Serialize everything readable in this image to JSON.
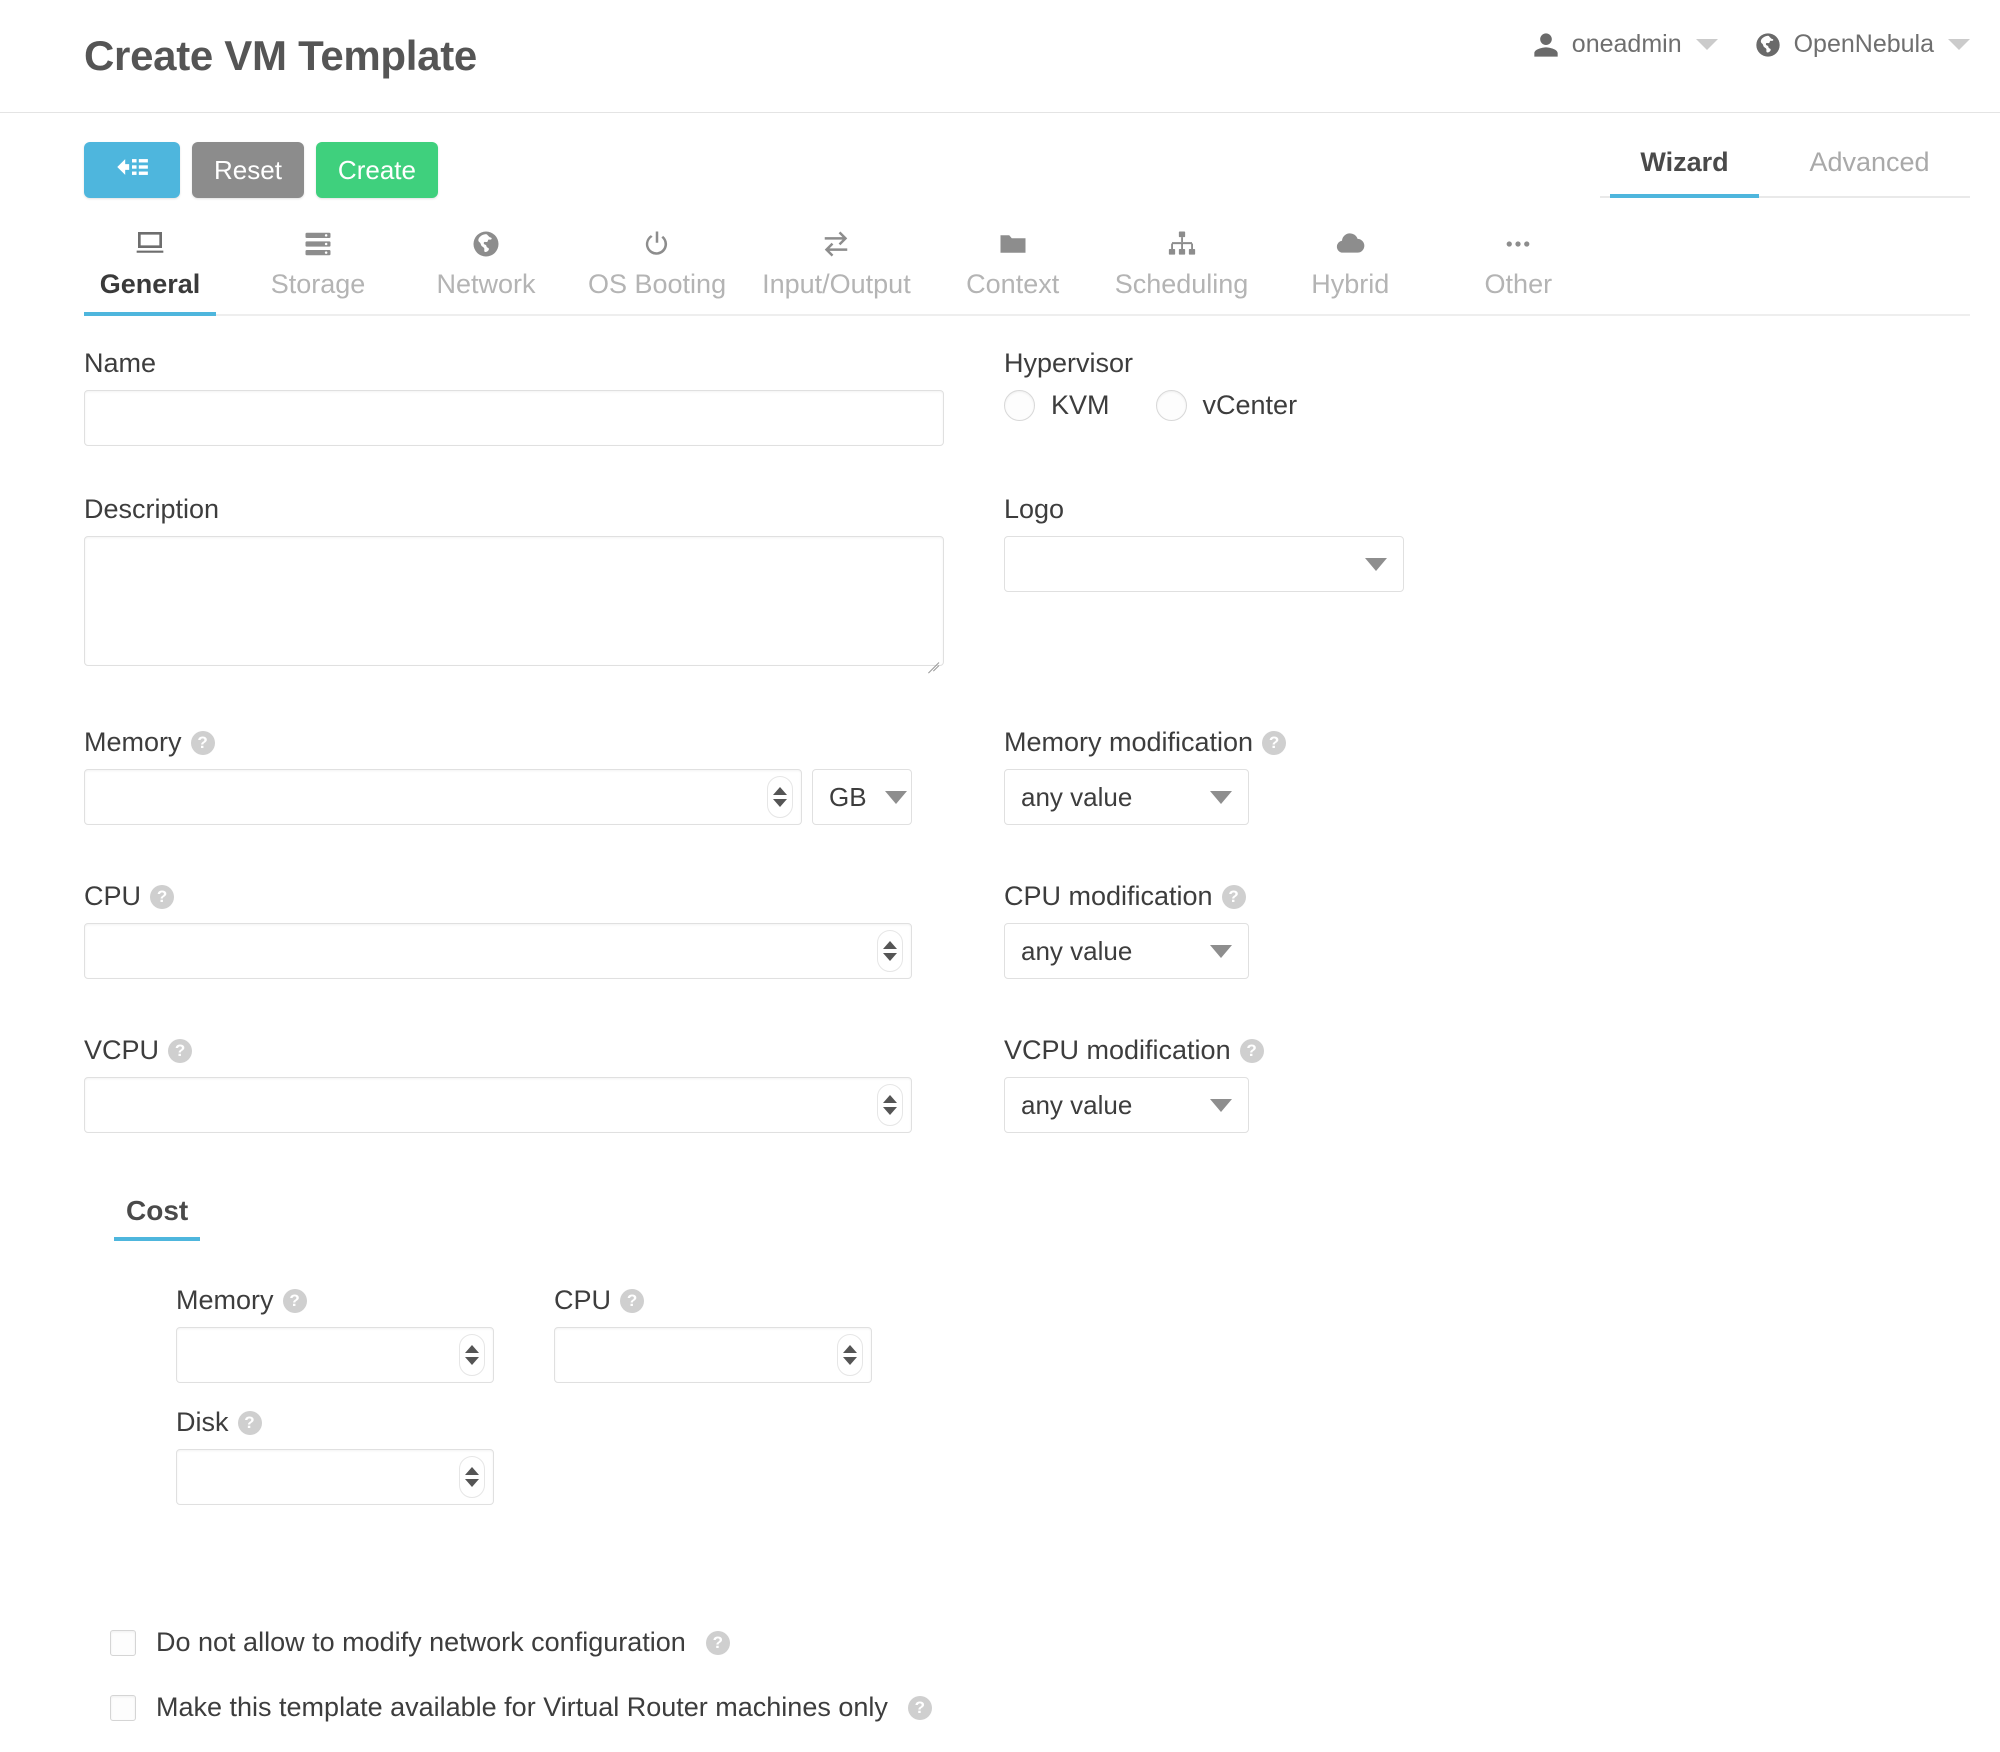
{
  "header": {
    "title": "Create VM Template",
    "user": {
      "name": "oneadmin",
      "icon": "user-icon"
    },
    "zone": {
      "name": "OpenNebula",
      "icon": "globe-icon"
    }
  },
  "toolbar": {
    "back_label": "",
    "reset_label": "Reset",
    "create_label": "Create",
    "back_icon": "back-to-list-icon",
    "colors": {
      "back": "#4eb6dd",
      "reset": "#8c8c8c",
      "create": "#3fd07d",
      "accent": "#4eb6dd"
    }
  },
  "mode_tabs": [
    {
      "label": "Wizard",
      "active": true
    },
    {
      "label": "Advanced",
      "active": false
    }
  ],
  "section_tabs": [
    {
      "label": "General",
      "icon": "desktop-icon",
      "active": true
    },
    {
      "label": "Storage",
      "icon": "server-icon",
      "active": false
    },
    {
      "label": "Network",
      "icon": "globe-icon",
      "active": false
    },
    {
      "label": "OS Booting",
      "icon": "power-icon",
      "active": false
    },
    {
      "label": "Input/Output",
      "icon": "exchange-icon",
      "active": false
    },
    {
      "label": "Context",
      "icon": "folder-icon",
      "active": false
    },
    {
      "label": "Scheduling",
      "icon": "sitemap-icon",
      "active": false
    },
    {
      "label": "Hybrid",
      "icon": "cloud-icon",
      "active": false
    },
    {
      "label": "Other",
      "icon": "ellipsis-icon",
      "active": false
    }
  ],
  "form": {
    "name": {
      "label": "Name",
      "value": "",
      "placeholder": ""
    },
    "description": {
      "label": "Description",
      "value": "",
      "placeholder": ""
    },
    "hypervisor": {
      "label": "Hypervisor",
      "options": [
        {
          "label": "KVM",
          "selected": false
        },
        {
          "label": "vCenter",
          "selected": false
        }
      ]
    },
    "logo": {
      "label": "Logo",
      "value": ""
    },
    "memory": {
      "label": "Memory",
      "help": "?",
      "value": "",
      "unit": "GB"
    },
    "memory_modification": {
      "label": "Memory modification",
      "help": "?",
      "value": "any value"
    },
    "cpu": {
      "label": "CPU",
      "help": "?",
      "value": ""
    },
    "cpu_modification": {
      "label": "CPU modification",
      "help": "?",
      "value": "any value"
    },
    "vcpu": {
      "label": "VCPU",
      "help": "?",
      "value": ""
    },
    "vcpu_modification": {
      "label": "VCPU modification",
      "help": "?",
      "value": "any value"
    }
  },
  "cost": {
    "tab_label": "Cost",
    "memory": {
      "label": "Memory",
      "help": "?",
      "value": ""
    },
    "cpu": {
      "label": "CPU",
      "help": "?",
      "value": ""
    },
    "disk": {
      "label": "Disk",
      "help": "?",
      "value": ""
    }
  },
  "checkboxes": [
    {
      "label": "Do not allow to modify network configuration",
      "help": "?",
      "checked": false
    },
    {
      "label": "Make this template available for Virtual Router machines only",
      "help": "?",
      "checked": false
    }
  ]
}
